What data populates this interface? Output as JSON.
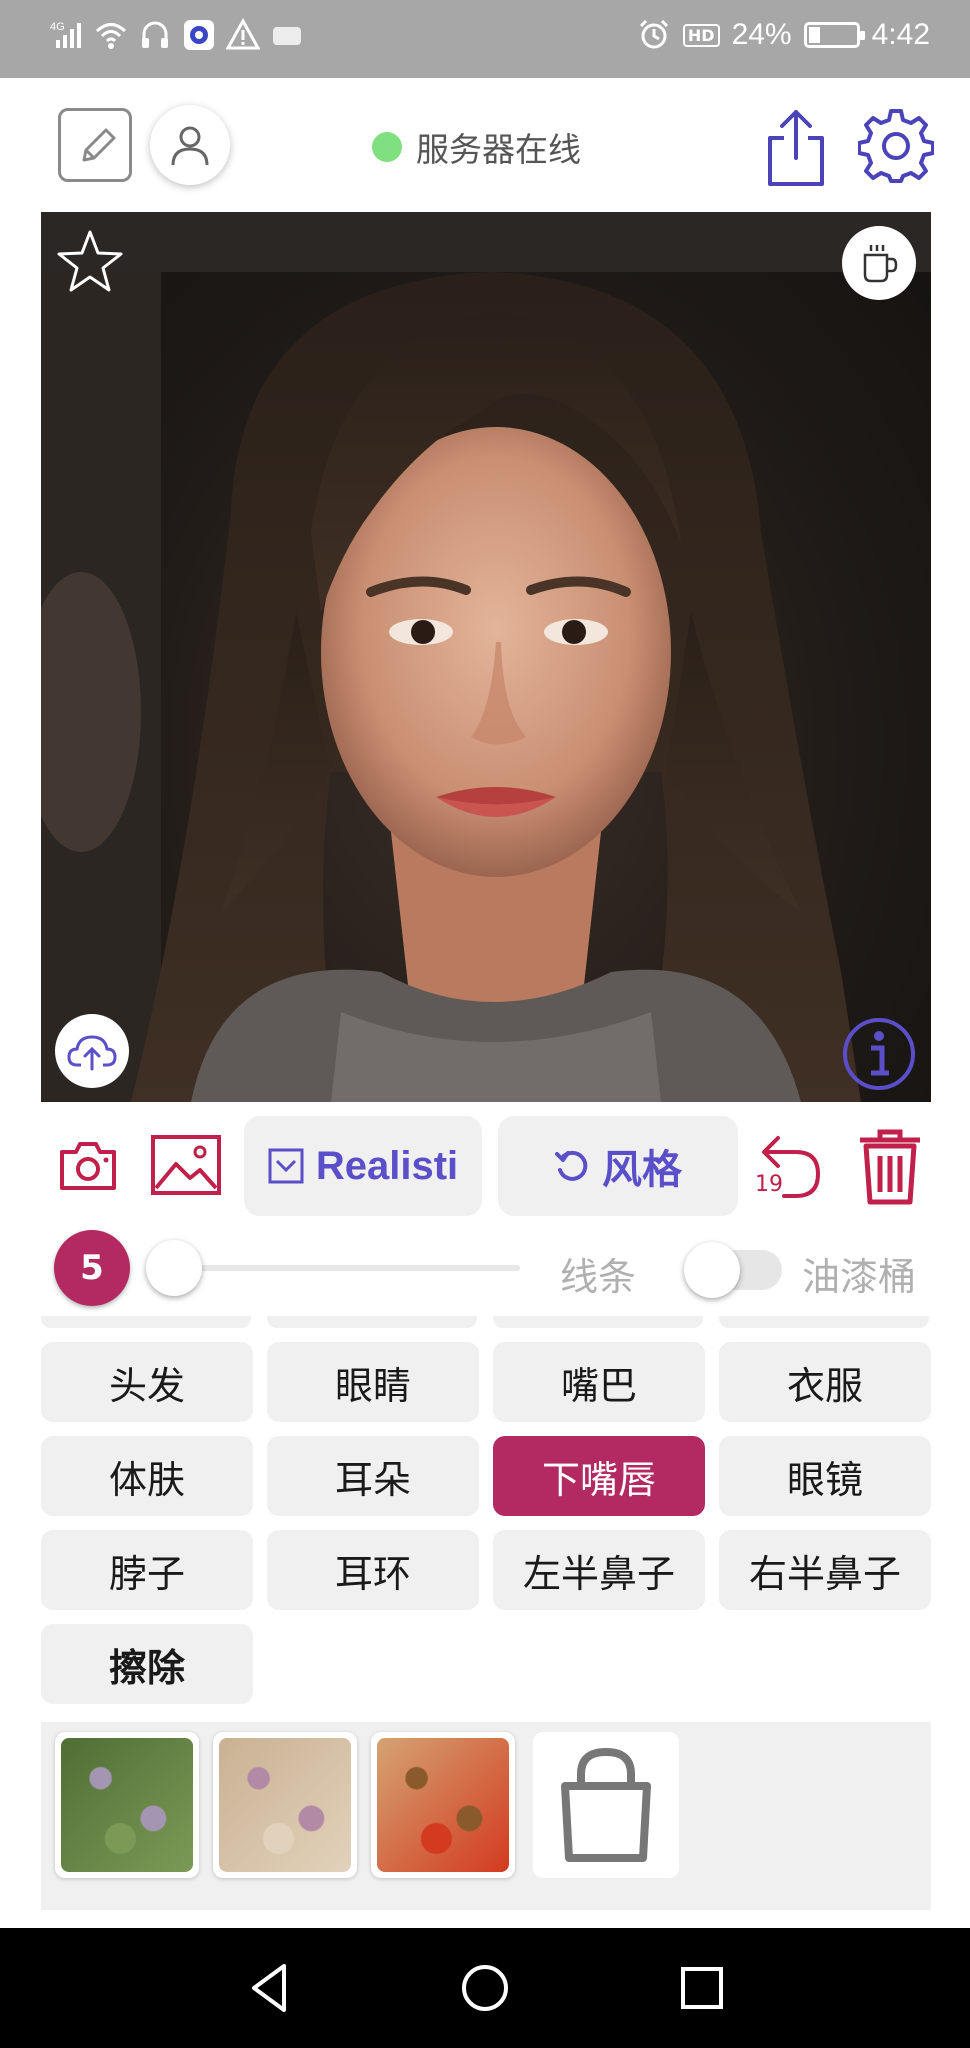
{
  "status_bar": {
    "network": "4G",
    "hd_label": "HD",
    "battery_percent": "24%",
    "battery_level": 0.24,
    "time": "4:42"
  },
  "topbar": {
    "server_status": "服务器在线",
    "status_color": "#7ee07e"
  },
  "actions": {
    "style_label": "Realisti",
    "restyle_label": "风格",
    "undo_count": "19"
  },
  "brush": {
    "size": "5",
    "line_label": "线条",
    "bucket_label": "油漆桶"
  },
  "categories": [
    {
      "label": "头发"
    },
    {
      "label": "眼睛"
    },
    {
      "label": "嘴巴"
    },
    {
      "label": "衣服"
    },
    {
      "label": "体肤"
    },
    {
      "label": "耳朵"
    },
    {
      "label": "下嘴唇",
      "active": true
    },
    {
      "label": "眼镜"
    },
    {
      "label": "脖子"
    },
    {
      "label": "耳环"
    },
    {
      "label": "左半鼻子"
    },
    {
      "label": "右半鼻子"
    },
    {
      "label": "擦除",
      "bold": true
    }
  ],
  "textures": [
    {
      "name": "texture-green",
      "colors": [
        "#4f6e35",
        "#7c9a56",
        "#a495b2"
      ]
    },
    {
      "name": "texture-beige",
      "colors": [
        "#c9b193",
        "#e2d2bb",
        "#b38aa5"
      ]
    },
    {
      "name": "texture-red",
      "colors": [
        "#d4a373",
        "#d33a1f",
        "#8a5a2b"
      ]
    }
  ],
  "colors": {
    "accent": "#b32a62",
    "icon_purple": "#5b4fc9",
    "icon_red": "#c0204a"
  }
}
